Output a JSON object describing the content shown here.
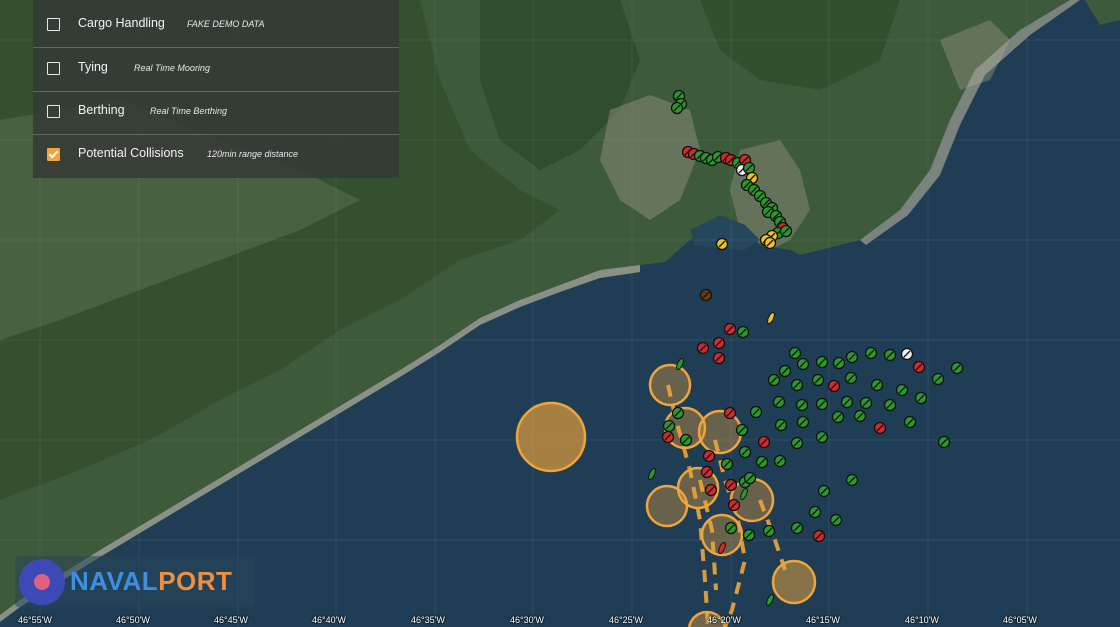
{
  "layers": [
    {
      "label": "Cargo Handling",
      "description": "FAKE DEMO DATA",
      "checked": false
    },
    {
      "label": "Tying",
      "description": "Real Time Mooring",
      "checked": false
    },
    {
      "label": "Berthing",
      "description": "Real Time Berthing",
      "checked": false
    },
    {
      "label": "Potential Collisions",
      "description": "120min range distance",
      "checked": true
    }
  ],
  "logo": {
    "part1": "NAVAL",
    "part2": "PORT"
  },
  "longitude_labels": [
    "46°55'W",
    "46°50'W",
    "46°45'W",
    "46°40'W",
    "46°35'W",
    "46°30'W",
    "46°25'W",
    "46°20'W",
    "46°15'W",
    "46°10'W",
    "46°05'W"
  ],
  "colors": {
    "ship_ok": "#2a9a2a",
    "ship_alert": "#d42a2a",
    "ship_warning": "#f0c020",
    "collision_zone": "#f0a43a",
    "ocean": "#1f3f55"
  }
}
